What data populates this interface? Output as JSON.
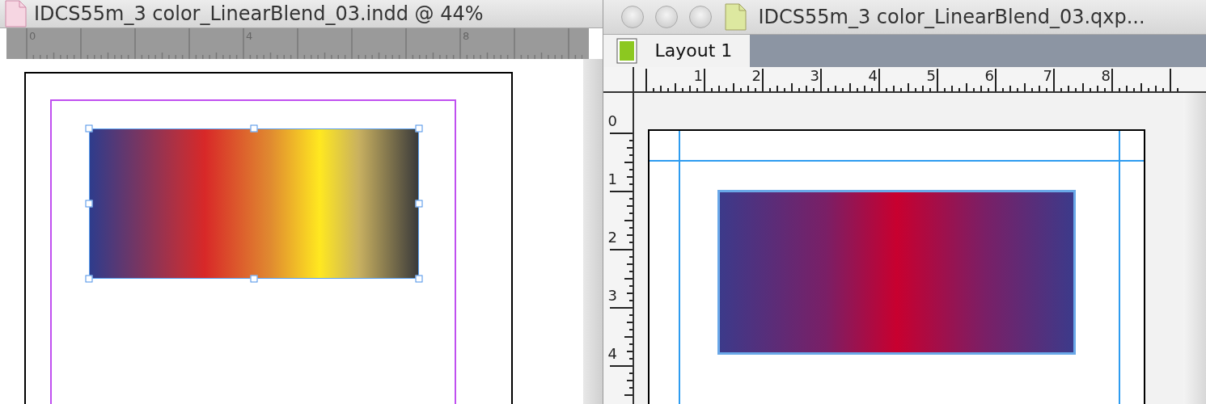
{
  "left_window": {
    "title": "IDCS55m_3 color_LinearBlend_03.indd @ 44%",
    "ruler_labels": [
      "0",
      "4",
      "8"
    ]
  },
  "right_window": {
    "title": "IDCS55m_3 color_LinearBlend_03.qxp...",
    "tabs": [
      {
        "label": "Layout 1",
        "selected": true
      }
    ],
    "ruler_top_labels": [
      "1",
      "2",
      "3",
      "4",
      "5",
      "6",
      "7",
      "8"
    ],
    "ruler_left_labels": [
      "0",
      "1",
      "2",
      "3",
      "4"
    ]
  }
}
